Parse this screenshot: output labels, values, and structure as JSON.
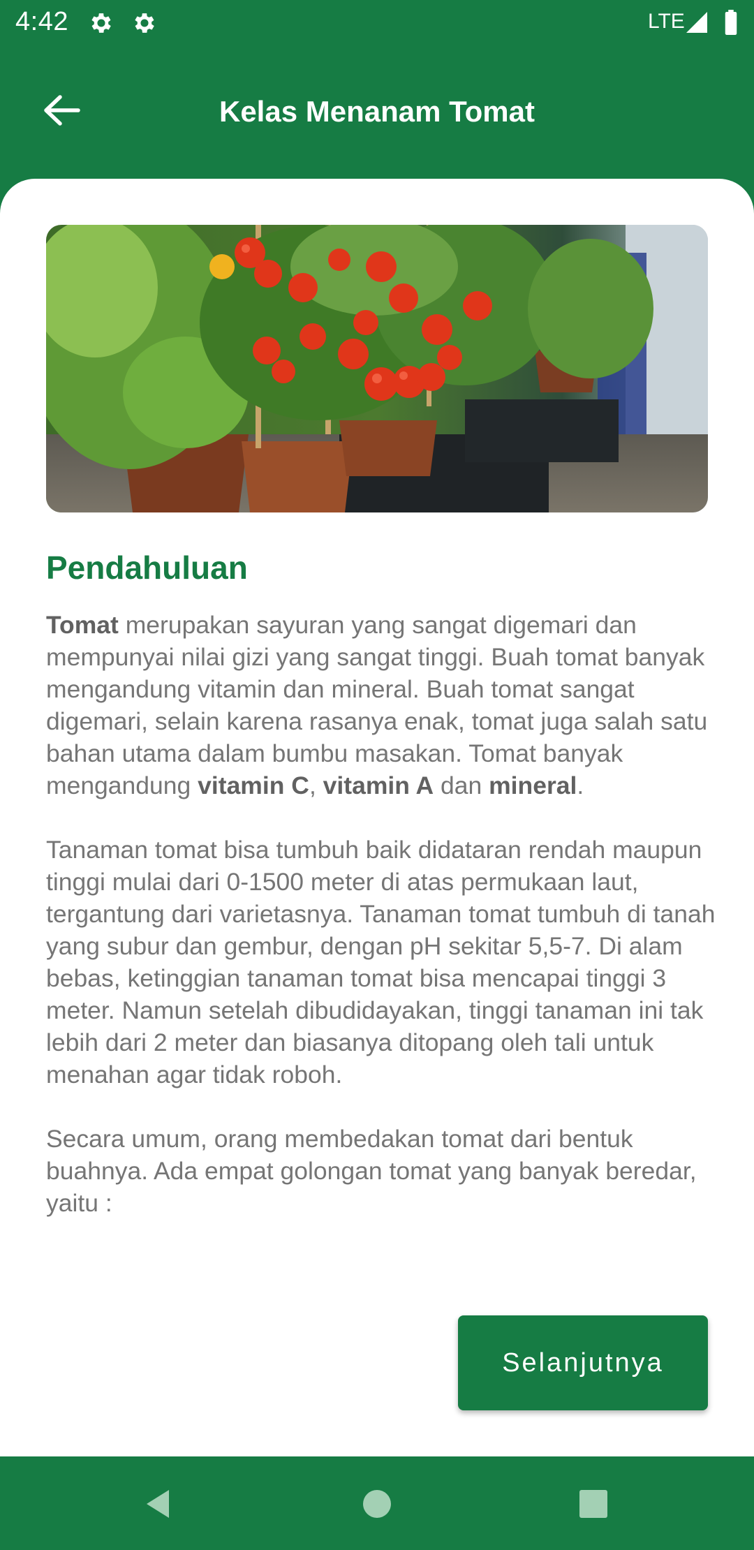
{
  "status_bar": {
    "time": "4:42",
    "network": "LTE",
    "icons": [
      "settings-icon",
      "settings-icon",
      "signal-icon",
      "battery-icon"
    ]
  },
  "app_bar": {
    "title": "Kelas Menanam Tomat",
    "back_icon": "arrow-left-icon"
  },
  "hero_image": {
    "description_icon": "tomato-plants-photo"
  },
  "section": {
    "title": "Pendahuluan"
  },
  "article": {
    "p1": {
      "t1": "Tomat",
      "t2": " merupakan sayuran yang sangat digemari dan mempunyai nilai gizi yang sangat tinggi. Buah tomat banyak mengandung vitamin dan mineral. Buah tomat sangat digemari, selain karena rasanya enak, tomat juga salah satu bahan utama dalam bumbu masakan. Tomat banyak mengandung ",
      "t3": "vitamin C",
      "t4": ", ",
      "t5": "vitamin A",
      "t6": " dan ",
      "t7": "mineral",
      "t8": "."
    },
    "p2": "Tanaman tomat bisa tumbuh baik didataran rendah maupun tinggi mulai dari 0-1500 meter di atas permukaan laut, tergantung dari varietasnya. Tanaman tomat tumbuh di tanah yang subur dan gembur, dengan pH sekitar 5,5-7. Di alam bebas, ketinggian tanaman tomat bisa mencapai tinggi 3 meter. Namun setelah dibudidayakan, tinggi tanaman ini tak lebih dari 2 meter dan biasanya ditopang oleh tali untuk menahan agar tidak roboh.",
    "p3": "Secara umum, orang membedakan tomat dari bentuk buahnya. Ada empat golongan tomat yang banyak beredar, yaitu :"
  },
  "actions": {
    "next_label": "Selanjutnya"
  },
  "nav_bar": {
    "icons": [
      "nav-back-icon",
      "nav-home-icon",
      "nav-recent-icon"
    ]
  },
  "colors": {
    "primary": "#167c44",
    "title_green": "#167c44",
    "body_text": "#757575",
    "background": "#ffffff"
  }
}
